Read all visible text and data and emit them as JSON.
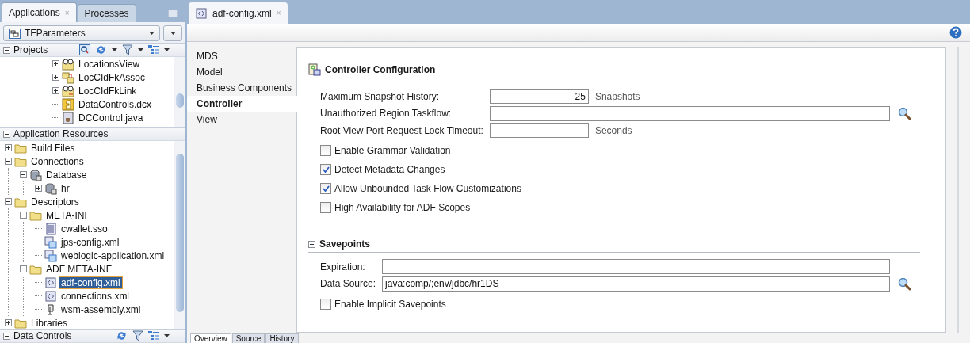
{
  "navigator": {
    "tabs": [
      {
        "label": "Applications",
        "selected": true,
        "close": "×"
      },
      {
        "label": "Processes",
        "selected": false
      }
    ],
    "application": "TFParameters",
    "panels": [
      {
        "title": "Projects",
        "expanded": true,
        "items": [
          {
            "label": "LocationsView",
            "kind": "view",
            "expanded": false,
            "selected": false
          },
          {
            "label": "LocCIdFkAssoc",
            "kind": "assoc",
            "expanded": false,
            "selected": false
          },
          {
            "label": "LocCIdFkLink",
            "kind": "link",
            "expanded": false,
            "selected": false
          },
          {
            "label": "DataControls.dcx",
            "kind": "dcx",
            "selected": false
          },
          {
            "label": "DCControl.java",
            "kind": "java",
            "selected": false
          }
        ]
      },
      {
        "title": "Application Resources",
        "expanded": true,
        "items": [
          {
            "label": "Build Files",
            "kind": "folder",
            "expanded": false,
            "selected": false
          },
          {
            "label": "Connections",
            "kind": "folder",
            "expanded": true,
            "selected": false,
            "children": [
              {
                "label": "Database",
                "kind": "database",
                "expanded": true,
                "selected": false,
                "children": [
                  {
                    "label": "hr",
                    "kind": "database",
                    "expanded": false,
                    "selected": false
                  }
                ]
              }
            ]
          },
          {
            "label": "Descriptors",
            "kind": "folder",
            "expanded": true,
            "selected": false,
            "children": [
              {
                "label": "META-INF",
                "kind": "folder",
                "expanded": true,
                "selected": false,
                "children": [
                  {
                    "label": "cwallet.sso",
                    "kind": "text",
                    "selected": false
                  },
                  {
                    "label": "jps-config.xml",
                    "kind": "xmlconfig",
                    "selected": false
                  },
                  {
                    "label": "weblogic-application.xml",
                    "kind": "xmlconfig",
                    "selected": false
                  }
                ]
              },
              {
                "label": "ADF META-INF",
                "kind": "folder",
                "expanded": true,
                "selected": false,
                "children": [
                  {
                    "label": "adf-config.xml",
                    "kind": "xml",
                    "selected": true
                  },
                  {
                    "label": "connections.xml",
                    "kind": "xml",
                    "selected": false
                  },
                  {
                    "label": "wsm-assembly.xml",
                    "kind": "wsm",
                    "selected": false
                  }
                ]
              }
            ]
          },
          {
            "label": "Libraries",
            "kind": "folder",
            "expanded": false,
            "selected": false
          }
        ]
      },
      {
        "title": "Data Controls",
        "expanded": true
      }
    ]
  },
  "editor": {
    "tabs": [
      {
        "label": "adf-config.xml",
        "selected": true,
        "close": "×"
      }
    ],
    "nav": [
      {
        "label": "MDS",
        "selected": false
      },
      {
        "label": "Model",
        "selected": false
      },
      {
        "label": "Business Components",
        "selected": false
      },
      {
        "label": "Controller",
        "selected": true
      },
      {
        "label": "View",
        "selected": false
      }
    ],
    "sections": [
      {
        "title": "Controller Configuration",
        "kind": "titled",
        "fields": [
          {
            "label": "Maximum Snapshot History:",
            "kind": "number",
            "value": "25",
            "suffix": "Snapshots"
          },
          {
            "label": "Unauthorized Region Taskflow:",
            "kind": "lookup"
          },
          {
            "label": "Root View Port Request Lock Timeout:",
            "kind": "number",
            "suffix": "Seconds"
          }
        ],
        "checkboxes": [
          {
            "label": "Enable Grammar Validation",
            "checked": false
          },
          {
            "label": "Detect Metadata Changes",
            "checked": true
          },
          {
            "label": "Allow Unbounded Task Flow Customizations",
            "checked": true
          },
          {
            "label": "High Availability for ADF Scopes",
            "checked": false
          }
        ]
      },
      {
        "title": "Savepoints",
        "kind": "collapsible",
        "expanded": true,
        "fields": [
          {
            "label": "Expiration:",
            "kind": "text"
          },
          {
            "label": "Data Source:",
            "kind": "lookup",
            "value": "java:comp/;env/jdbc/hr1DS"
          }
        ],
        "checkboxes": [
          {
            "label": "Enable Implicit Savepoints",
            "checked": false
          }
        ]
      }
    ],
    "bottom_tabs": [
      {
        "label": "Overview",
        "selected": true
      },
      {
        "label": "Source",
        "selected": false
      },
      {
        "label": "History",
        "selected": false
      }
    ]
  }
}
